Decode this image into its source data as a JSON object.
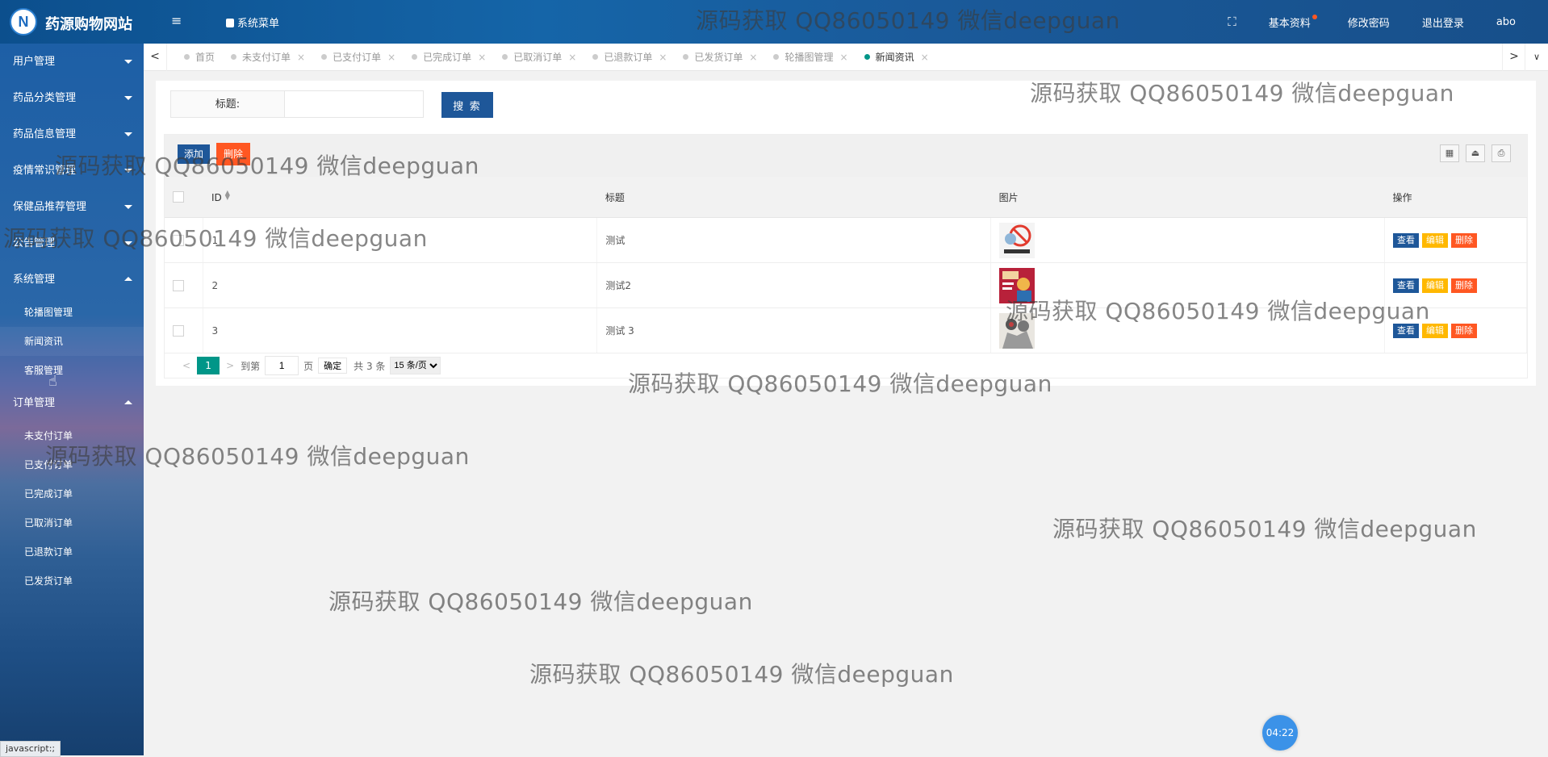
{
  "header": {
    "logo_letter": "N",
    "site_name": "药源购物网站",
    "menu_toggle": "≡",
    "system_menu": "系统菜单",
    "fullscreen": "⛶",
    "links": [
      "基本资料",
      "修改密码",
      "退出登录",
      "abo"
    ]
  },
  "sidebar": {
    "groups_top": [
      "用户管理",
      "药品分类管理",
      "药品信息管理",
      "疫情常识管理",
      "保健品推荐管理",
      "公告管理"
    ],
    "system_group": "系统管理",
    "system_items": [
      "轮播图管理",
      "新闻资讯",
      "客服管理"
    ],
    "order_group": "订单管理",
    "order_items": [
      "未支付订单",
      "已支付订单",
      "已完成订单",
      "已取消订单",
      "已退款订单",
      "已发货订单"
    ]
  },
  "tabs": {
    "prev": "<",
    "next": ">",
    "more": "∨",
    "items": [
      "首页",
      "未支付订单",
      "已支付订单",
      "已完成订单",
      "已取消订单",
      "已退款订单",
      "已发货订单",
      "轮播图管理",
      "新闻资讯"
    ],
    "close": "×"
  },
  "search": {
    "label": "标题:",
    "value": "",
    "button": "搜 索"
  },
  "toolbar": {
    "add": "添加",
    "delete": "删除"
  },
  "table": {
    "columns": [
      "ID",
      "标题",
      "图片",
      "操作"
    ],
    "rows": [
      {
        "id": "1",
        "title": "测试"
      },
      {
        "id": "2",
        "title": "测试2"
      },
      {
        "id": "3",
        "title": "测试 3"
      }
    ],
    "ops": {
      "view": "查看",
      "edit": "编辑",
      "delete": "删除"
    }
  },
  "pager": {
    "current": "1",
    "goto_label": "到第",
    "goto_value": "1",
    "page_unit": "页",
    "confirm": "确定",
    "total": "共 3 条",
    "page_size": "15 条/页"
  },
  "watermark": "源码获取 QQ86050149 微信deepguan",
  "timer": "04:22",
  "status_bar": "javascript:;"
}
